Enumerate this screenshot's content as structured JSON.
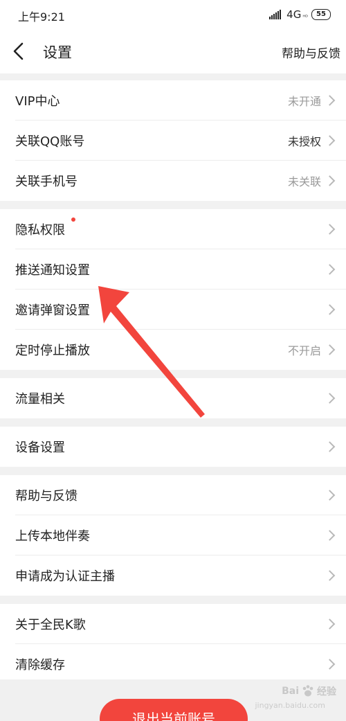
{
  "status_bar": {
    "time": "上午9:21",
    "network": "4G",
    "network_sub": "ᴴᴰ",
    "battery": "55"
  },
  "header": {
    "title": "设置",
    "help_link": "帮助与反馈"
  },
  "sections": [
    {
      "items": [
        {
          "label": "VIP中心",
          "value": "未开通",
          "value_style": "light"
        },
        {
          "label": "关联QQ账号",
          "value": "未授权",
          "value_style": "dark"
        },
        {
          "label": "关联手机号",
          "value": "未关联",
          "value_style": "light"
        }
      ]
    },
    {
      "items": [
        {
          "label": "隐私权限",
          "value": "",
          "badge": true
        },
        {
          "label": "推送通知设置",
          "value": ""
        },
        {
          "label": "邀请弹窗设置",
          "value": ""
        },
        {
          "label": "定时停止播放",
          "value": "不开启",
          "value_style": "light"
        }
      ]
    },
    {
      "items": [
        {
          "label": "流量相关",
          "value": ""
        }
      ]
    },
    {
      "items": [
        {
          "label": "设备设置",
          "value": ""
        }
      ]
    },
    {
      "items": [
        {
          "label": "帮助与反馈",
          "value": ""
        },
        {
          "label": "上传本地伴奏",
          "value": ""
        },
        {
          "label": "申请成为认证主播",
          "value": ""
        }
      ]
    },
    {
      "items": [
        {
          "label": "关于全民K歌",
          "value": ""
        },
        {
          "label": "清除缓存",
          "value": ""
        }
      ]
    }
  ],
  "logout_button": "退出当前账号",
  "watermark": {
    "brand_left": "Bai",
    "brand_right": "经验",
    "sub": "jingyan.baidu.com"
  },
  "colors": {
    "accent": "#f2453d",
    "arrow": "#f2453d",
    "background": "#f1f1f1"
  }
}
